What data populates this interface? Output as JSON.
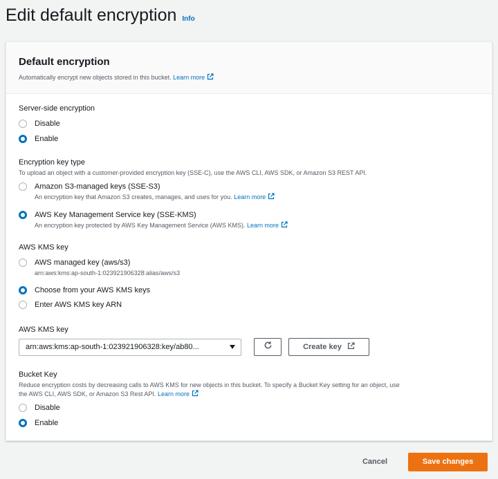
{
  "header": {
    "title": "Edit default encryption",
    "info_label": "Info"
  },
  "panel": {
    "title": "Default encryption",
    "description": "Automatically encrypt new objects stored in this bucket.",
    "learn_more": "Learn more"
  },
  "server_side": {
    "label": "Server-side encryption",
    "options": [
      {
        "label": "Disable",
        "selected": false
      },
      {
        "label": "Enable",
        "selected": true
      }
    ]
  },
  "key_type": {
    "label": "Encryption key type",
    "description": "To upload an object with a customer-provided encryption key (SSE-C), use the AWS CLI, AWS SDK, or Amazon S3 REST API.",
    "options": [
      {
        "label": "Amazon S3-managed keys (SSE-S3)",
        "description": "An encryption key that Amazon S3 creates, manages, and uses for you.",
        "learn_more": "Learn more",
        "selected": false
      },
      {
        "label": "AWS Key Management Service key (SSE-KMS)",
        "description": "An encryption key protected by AWS Key Management Service (AWS KMS).",
        "learn_more": "Learn more",
        "selected": true
      }
    ]
  },
  "kms_key_choice": {
    "label": "AWS KMS key",
    "options": [
      {
        "label": "AWS managed key (aws/s3)",
        "description": "arn:aws:kms:ap-south-1:023921906328:alias/aws/s3",
        "selected": false
      },
      {
        "label": "Choose from your AWS KMS keys",
        "selected": true
      },
      {
        "label": "Enter AWS KMS key ARN",
        "selected": false
      }
    ]
  },
  "kms_key_select": {
    "label": "AWS KMS key",
    "value": "arn:aws:kms:ap-south-1:023921906328:key/ab80...",
    "refresh_icon": "refresh-icon",
    "create_key_label": "Create key"
  },
  "bucket_key": {
    "label": "Bucket Key",
    "description_line1": "Reduce encryption costs by decreasing calls to AWS KMS for new objects in this bucket. To specify a Bucket Key setting for an object, use",
    "description_line2": "the AWS CLI, AWS SDK, or Amazon S3 Rest API.",
    "learn_more": "Learn more",
    "options": [
      {
        "label": "Disable",
        "selected": false
      },
      {
        "label": "Enable",
        "selected": true
      }
    ]
  },
  "footer": {
    "cancel_label": "Cancel",
    "save_label": "Save changes"
  },
  "colors": {
    "accent": "#0073bb",
    "primary_button": "#ec7211",
    "background": "#f2f3f3"
  }
}
